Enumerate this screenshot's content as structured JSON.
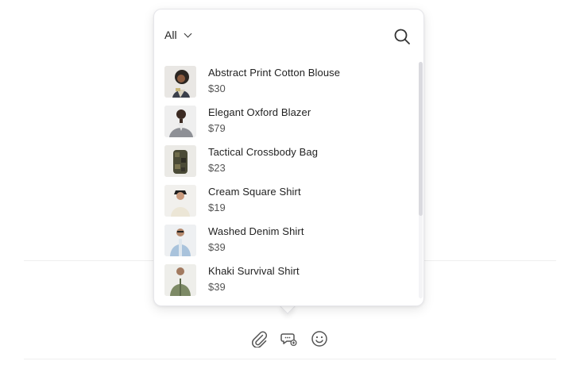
{
  "filter": {
    "selected": "All"
  },
  "products": [
    {
      "name": "Abstract Print Cotton Blouse",
      "price": "$30"
    },
    {
      "name": "Elegant Oxford Blazer",
      "price": "$79"
    },
    {
      "name": "Tactical Crossbody Bag",
      "price": "$23"
    },
    {
      "name": "Cream Square Shirt",
      "price": "$19"
    },
    {
      "name": "Washed Denim Shirt",
      "price": "$39"
    },
    {
      "name": "Khaki Survival Shirt",
      "price": "$39"
    }
  ],
  "toolbar": {
    "icons": [
      "paperclip-icon",
      "chat-product-icon",
      "emoji-icon"
    ]
  },
  "colors": {
    "text": "#222222",
    "muted": "#555555",
    "border": "#e6e6ea",
    "scrollbar": "#dadadf"
  }
}
